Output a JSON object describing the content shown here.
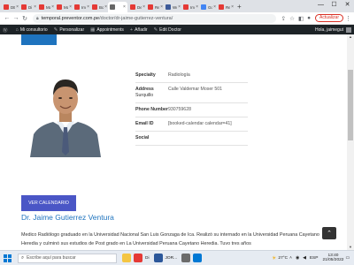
{
  "browser": {
    "tabs": [
      {
        "label": "DE",
        "color": "#e53935"
      },
      {
        "label": "Di",
        "color": "#e53935"
      },
      {
        "label": "Ma",
        "color": "#e53935"
      },
      {
        "label": "Ma",
        "color": "#e53935"
      },
      {
        "label": "Im",
        "color": "#e53935"
      },
      {
        "label": "Bo",
        "color": "#e53935"
      },
      {
        "label": "",
        "color": "#666666",
        "active": true
      },
      {
        "label": "De",
        "color": "#e53935"
      },
      {
        "label": "Re",
        "color": "#e53935"
      },
      {
        "label": "Wo",
        "color": "#3c5a99"
      },
      {
        "label": "Im",
        "color": "#e53935"
      },
      {
        "label": "Go",
        "color": "#4285f4"
      },
      {
        "label": "Re",
        "color": "#e53935"
      }
    ],
    "url_domain": "temporal.preventor.com.pe",
    "url_path": "/doctor/dr-jaime-gutierrez-ventura/",
    "update_label": "Actualizar",
    "window_controls": {
      "minimize": "—",
      "maximize": "☐",
      "close": "✕"
    }
  },
  "wp_admin_bar": {
    "items": [
      {
        "icon": "wp-logo-icon",
        "glyph": "Ⓦ",
        "label": ""
      },
      {
        "icon": "home-icon",
        "glyph": "⌂",
        "label": "Mi consultorio"
      },
      {
        "icon": "brush-icon",
        "glyph": "✎",
        "label": "Personalizar"
      },
      {
        "icon": "calendar-icon",
        "glyph": "▦",
        "label": "Appointments"
      },
      {
        "icon": "plus-icon",
        "glyph": "+",
        "label": "Añadir"
      },
      {
        "icon": "pencil-icon",
        "glyph": "✎",
        "label": "Edit Doctor"
      }
    ],
    "greeting": "Hola, jaimegut"
  },
  "doctor": {
    "details": [
      {
        "key": "Specialty",
        "sub": "",
        "value": "Radiología"
      },
      {
        "key": "Address",
        "sub": "Surquillo",
        "value": "Calle Valdemar Moser 501"
      },
      {
        "key": "Phone Number",
        "sub": "",
        "value": "930759628"
      },
      {
        "key": "Email ID",
        "sub": "",
        "value": "[booked-calendar calendar=41]"
      },
      {
        "key": "Social",
        "sub": "",
        "value": ""
      }
    ],
    "calendar_button": "VER CALENDARIO",
    "name": "Dr. Jaime Gutierrez Ventura",
    "bio": "Medico Radiólogo graduado en la Universidad Nacional San Luis Gonzaga de Ica. Realizó su internado en la Universidad Peruana Cayetano Heredia y culminó sus estudios de Post grado en La Universidad Peruana Cayetano Heredia. Tuvo tres años"
  },
  "taskbar": {
    "search_placeholder": "Escribe aquí para buscar",
    "apps": [
      {
        "name": "file-explorer-icon",
        "color": "#f4c542",
        "label": ""
      },
      {
        "name": "chrome-icon",
        "color": "#e53935",
        "label": "Di"
      },
      {
        "name": "word-icon",
        "color": "#2b579a",
        "label": "JOR..."
      },
      {
        "name": "store-icon",
        "color": "#6b6b6b",
        "label": ""
      },
      {
        "name": "photos-icon",
        "color": "#0078d4",
        "label": ""
      }
    ],
    "weather": "27°C",
    "lang": "ESP",
    "time": "13:40",
    "date": "21/05/2022"
  },
  "colors": {
    "accent": "#1e73be",
    "button": "#4a56c6",
    "wp_bar": "#1d2327"
  }
}
